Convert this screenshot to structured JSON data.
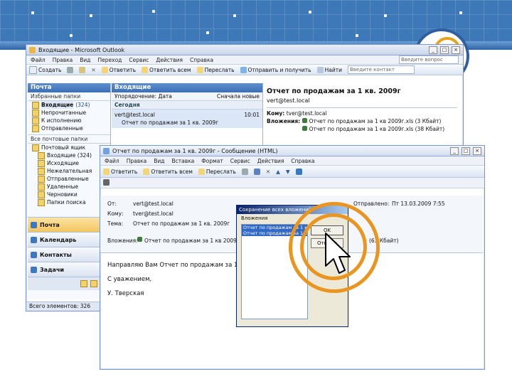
{
  "colors": {
    "accent": "#3d78b8",
    "highlight": "#e9951f",
    "title_bar": "#c9d6ea"
  },
  "outlook": {
    "title": "Входящие - Microsoft Outlook",
    "menu": [
      "Файл",
      "Правка",
      "Вид",
      "Переход",
      "Сервис",
      "Действия",
      "Справка"
    ],
    "help_box": "Введите вопрос",
    "toolbar": {
      "create": "Создать",
      "reply": "Ответить",
      "reply_all": "Ответить всем",
      "forward": "Переслать",
      "send_receive": "Отправить и получить",
      "find": "Найти",
      "contact_search": "Введите контакт"
    },
    "nav": {
      "header": "Почта",
      "favorites_title": "Избранные папки",
      "favorites": [
        {
          "label": "Входящие",
          "count": "(324)"
        },
        {
          "label": "Непрочитанные",
          "count": ""
        },
        {
          "label": "К исполнению",
          "count": ""
        },
        {
          "label": "Отправленные",
          "count": ""
        }
      ],
      "all_folders_title": "Все почтовые папки",
      "folders": [
        "Почтовый ящик",
        "Входящие (324)",
        "Исходящие",
        "Нежелательная",
        "Отправленные",
        "Удаленные",
        "Черновики",
        "Папки поиска"
      ],
      "buttons": [
        "Почта",
        "Календарь",
        "Контакты",
        "Задачи"
      ],
      "status": "Всего элементов: 326"
    },
    "list": {
      "header": "Входящие",
      "col_arrange": "Упорядочение: Дата",
      "col_sort": "Сначала новые",
      "group": "Сегодня",
      "item_from": "vert@test.local",
      "item_time": "10:01",
      "item_subject": "Отчет по продажам за 1 кв. 2009г"
    },
    "reading": {
      "subject": "Отчет по продажам за 1 кв. 2009г",
      "from": "vert@test.local",
      "to_label": "Кому:",
      "to_value": "tver@test.local",
      "attach_label": "Вложения:",
      "attachments": [
        "Отчет по продажам за 1 кв 2009г.xls (3 Кбайт)",
        "Отчет по продажам за 1 кв 2009г.xls (38 Кбайт)"
      ]
    }
  },
  "message": {
    "title": "Отчет по продажам за 1 кв. 2009г - Сообщение (HTML)",
    "menu": [
      "Файл",
      "Правка",
      "Вид",
      "Вставка",
      "Формат",
      "Сервис",
      "Действия",
      "Справка"
    ],
    "toolbar": {
      "reply": "Ответить",
      "reply_all": "Ответить всем",
      "forward": "Переслать"
    },
    "from_label": "От:",
    "from_value": "vert@test.local",
    "to_label": "Кому:",
    "to_value": "tver@test.local",
    "subject_label": "Тема:",
    "subject_value": "Отчет по продажам за 1 кв. 2009г",
    "sent_label": "Отправлено:",
    "sent_value": "Пт 13.03.2009 7:55",
    "attach_label": "Вложения:",
    "attach_value": "Отчет по продажам за 1 кв 2009г.xls",
    "attach_size": "(63 Кбайт)",
    "body": [
      "Направляю Вам Отчет по продажам за 1",
      "С уважением,",
      "У. Тверская"
    ]
  },
  "dialog": {
    "title": "Сохранение всех вложений",
    "label": "Вложения",
    "items": [
      "Отчет по продажам за 1 кв. 2009г.xls",
      "Отчет по продажам за 1 кв. 2009г.xls"
    ],
    "ok": "OK",
    "cancel": "Отмена"
  }
}
